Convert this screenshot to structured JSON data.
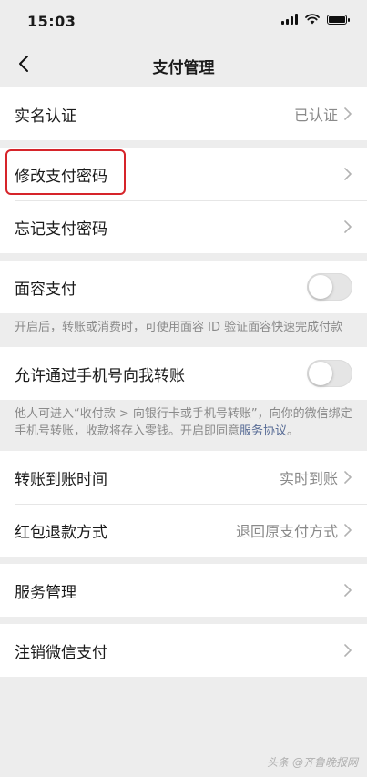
{
  "status": {
    "time": "15:03"
  },
  "nav": {
    "title": "支付管理"
  },
  "groups": {
    "realname": {
      "label": "实名认证",
      "value": "已认证"
    },
    "password": {
      "change": "修改支付密码",
      "forgot": "忘记支付密码"
    },
    "faceid": {
      "label": "面容支付",
      "on": false,
      "note": "开启后，转账或消费时，可使用面容 ID 验证面容快速完成付款"
    },
    "phone_transfer": {
      "label": "允许通过手机号向我转账",
      "on": false,
      "note_text": "他人可进入“收付款 > 向银行卡或手机号转账”，向你的微信绑定手机号转账，收款将存入零钱。开启即同意",
      "note_link": "服务协议",
      "note_end": "。"
    },
    "transfer": {
      "arrival_label": "转账到账时间",
      "arrival_value": "实时到账",
      "refund_label": "红包退款方式",
      "refund_value": "退回原支付方式"
    },
    "service": {
      "label": "服务管理"
    },
    "cancel": {
      "label": "注销微信支付"
    }
  },
  "watermark": "头条 @齐鲁晚报网",
  "colors": {
    "highlight": "#d6242a",
    "link": "#576b95",
    "background": "#ededed"
  }
}
